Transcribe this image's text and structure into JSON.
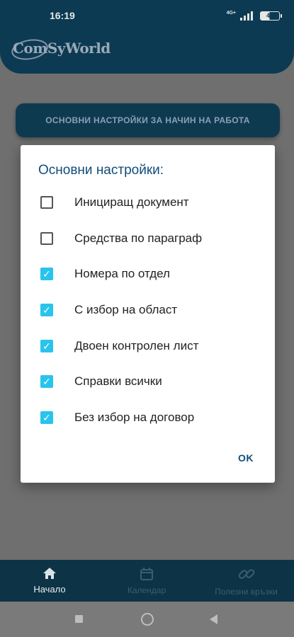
{
  "status_bar": {
    "time": "16:19",
    "network": "4G+",
    "battery": "49"
  },
  "header": {
    "logo_text": "ComSyWorld"
  },
  "main": {
    "settings_button_label": "ОСНОВНИ НАСТРОЙКИ ЗА НАЧИН НА РАБОТА"
  },
  "dialog": {
    "title": "Основни настройки:",
    "options": [
      {
        "label": "Инициращ документ",
        "checked": false
      },
      {
        "label": "Средства по параграф",
        "checked": false
      },
      {
        "label": "Номера по отдел",
        "checked": true
      },
      {
        "label": "С избор на област",
        "checked": true
      },
      {
        "label": "Двоен контролен лист",
        "checked": true
      },
      {
        "label": "Справки всички",
        "checked": true
      },
      {
        "label": "Без избор на договор",
        "checked": true
      }
    ],
    "ok_label": "OK"
  },
  "bottom_nav": {
    "items": [
      {
        "label": "Начало",
        "icon": "home-icon",
        "active": true
      },
      {
        "label": "Календар",
        "icon": "calendar-icon",
        "active": false
      },
      {
        "label": "Полезни връзки",
        "icon": "link-icon",
        "active": false
      }
    ]
  },
  "colors": {
    "header_bg": "#0c3a52",
    "accent_checkbox": "#29c4ec",
    "dialog_title": "#114d78"
  }
}
